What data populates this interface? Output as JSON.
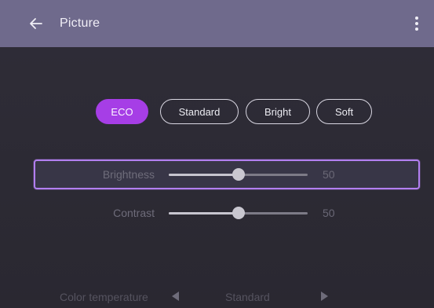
{
  "header": {
    "title": "Picture",
    "back_icon": "arrow-left-icon",
    "menu_icon": "more-vertical-icon"
  },
  "picture_modes": {
    "selected": "ECO",
    "options": [
      "ECO",
      "Standard",
      "Bright",
      "Soft"
    ]
  },
  "brightness": {
    "label": "Brightness",
    "value": "50",
    "level_fraction": 0.5
  },
  "contrast": {
    "label": "Contrast",
    "value": "50",
    "level_fraction": 0.5
  },
  "color_temperature": {
    "label": "Color temperature",
    "value": "Standard"
  },
  "colors": {
    "header_bg": "#6f6a8c",
    "body_bg": "#2d2b35",
    "accent": "#a63ee6",
    "focus_border": "#b27ff0"
  }
}
